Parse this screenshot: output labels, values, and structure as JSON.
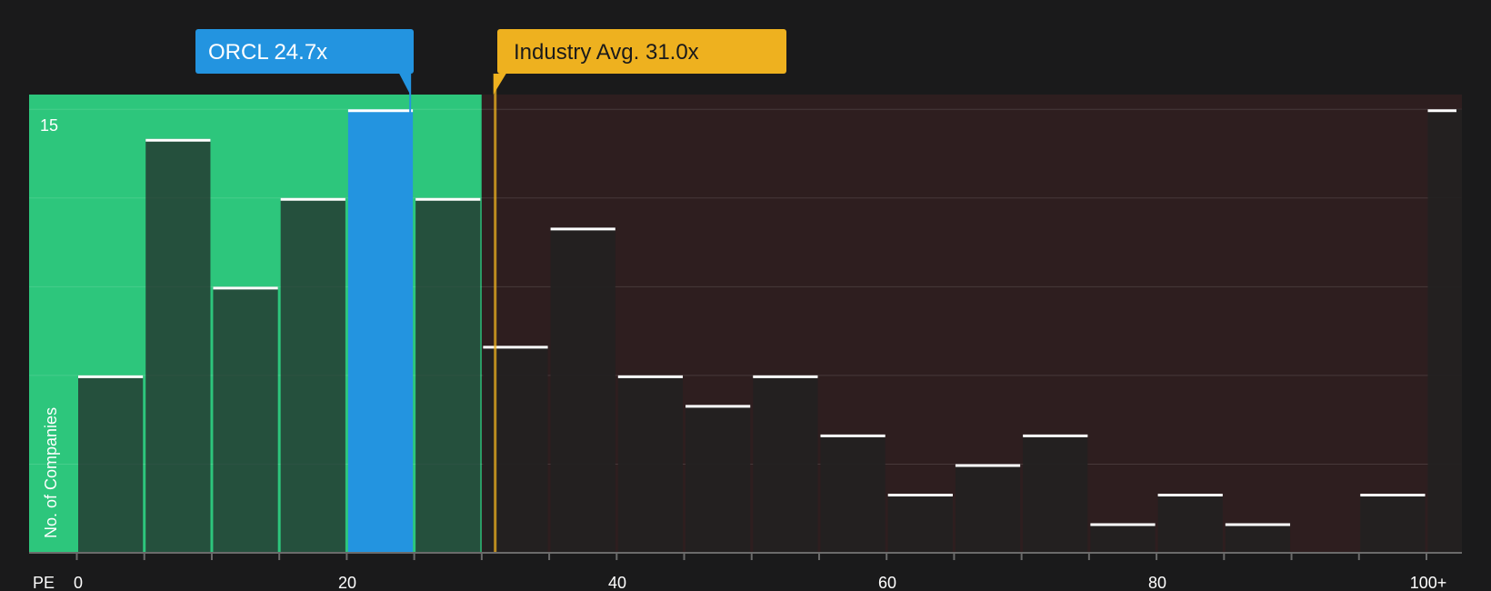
{
  "chart_data": {
    "type": "bar",
    "xlabel": "PE",
    "ylabel": "No. of Companies",
    "x_ticks": [
      "0",
      "20",
      "40",
      "60",
      "80",
      "100+"
    ],
    "y_ticks": [
      "15"
    ],
    "ylim": [
      0,
      15.5
    ],
    "bin_width": 5,
    "bins": [
      {
        "x0": 0,
        "x1": 5,
        "value": 6
      },
      {
        "x0": 5,
        "x1": 10,
        "value": 14
      },
      {
        "x0": 10,
        "x1": 15,
        "value": 9
      },
      {
        "x0": 15,
        "x1": 20,
        "value": 12
      },
      {
        "x0": 20,
        "x1": 25,
        "value": 15
      },
      {
        "x0": 25,
        "x1": 30,
        "value": 12
      },
      {
        "x0": 30,
        "x1": 35,
        "value": 7
      },
      {
        "x0": 35,
        "x1": 40,
        "value": 11
      },
      {
        "x0": 40,
        "x1": 45,
        "value": 6
      },
      {
        "x0": 45,
        "x1": 50,
        "value": 5
      },
      {
        "x0": 50,
        "x1": 55,
        "value": 6
      },
      {
        "x0": 55,
        "x1": 60,
        "value": 4
      },
      {
        "x0": 60,
        "x1": 65,
        "value": 2
      },
      {
        "x0": 65,
        "x1": 70,
        "value": 3
      },
      {
        "x0": 70,
        "x1": 75,
        "value": 4
      },
      {
        "x0": 75,
        "x1": 80,
        "value": 1
      },
      {
        "x0": 80,
        "x1": 85,
        "value": 2
      },
      {
        "x0": 85,
        "x1": 90,
        "value": 1
      },
      {
        "x0": 90,
        "x1": 95,
        "value": 0
      },
      {
        "x0": 95,
        "x1": 100,
        "value": 2
      },
      {
        "x0": 100,
        "x1": 105,
        "value": 15
      }
    ],
    "company": {
      "label": "ORCL 24.7x",
      "value": 24.7,
      "color": "#2394e0"
    },
    "industry": {
      "label": "Industry Avg. 31.0x",
      "value": 31.0,
      "color": "#eeb11f"
    },
    "undervalued_zone": {
      "max": 30,
      "color": "#2dc67c"
    },
    "overvalued_zone_color": "#2e1e1f",
    "grid": true
  }
}
